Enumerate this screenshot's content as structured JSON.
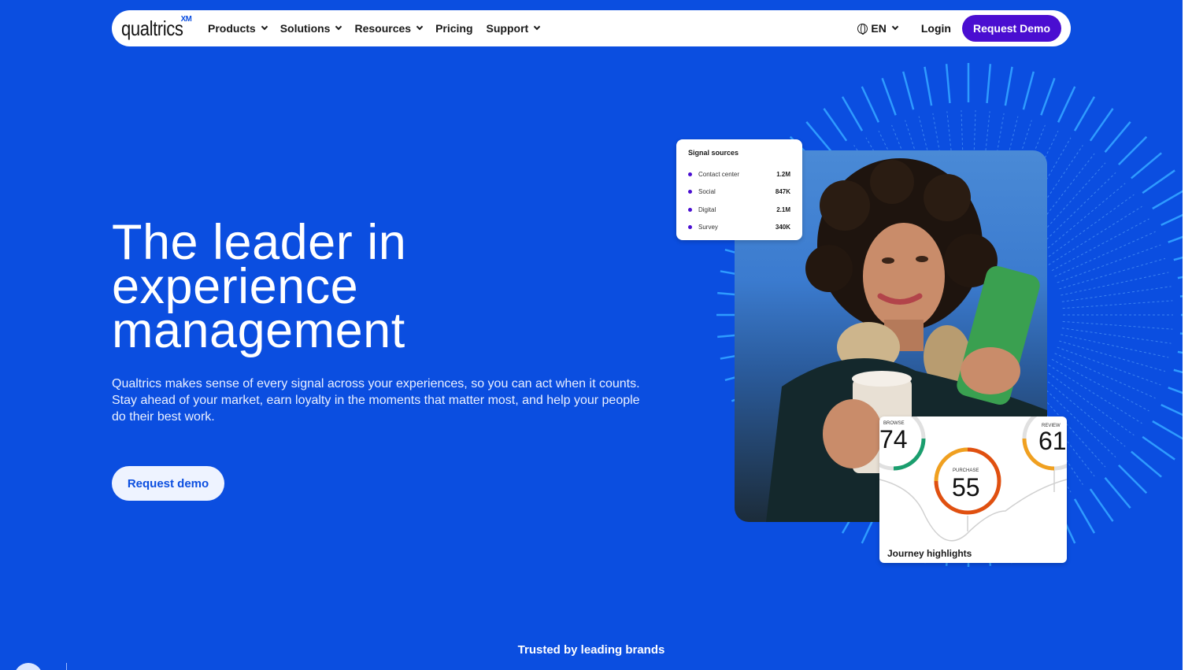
{
  "nav": {
    "logo": "qualtrics",
    "logo_sup": "XM",
    "items": [
      {
        "label": "Products",
        "dropdown": true
      },
      {
        "label": "Solutions",
        "dropdown": true
      },
      {
        "label": "Resources",
        "dropdown": true
      },
      {
        "label": "Pricing",
        "dropdown": false
      },
      {
        "label": "Support",
        "dropdown": true
      }
    ],
    "language": "EN",
    "login": "Login",
    "request_demo": "Request Demo"
  },
  "hero": {
    "title_line1": "The leader in",
    "title_line2": "experience",
    "title_line3": "management",
    "subtitle": "Qualtrics makes sense of every signal across your experiences, so you can act when it counts. Stay ahead of your market, earn loyalty in the moments that matter most, and help your people do their best work.",
    "cta": "Request demo"
  },
  "signal_card": {
    "title": "Signal sources",
    "rows": [
      {
        "label": "Contact center",
        "value": "1.2M"
      },
      {
        "label": "Social",
        "value": "847K"
      },
      {
        "label": "Digital",
        "value": "2.1M"
      },
      {
        "label": "Survey",
        "value": "340K"
      }
    ]
  },
  "journey_card": {
    "title": "Journey highlights",
    "browse_label": "BROWSE",
    "browse_value": "74",
    "review_label": "REVIEW",
    "review_value": "61",
    "purchase_label": "PURCHASE",
    "purchase_value": "55"
  },
  "footer": {
    "trusted": "Trusted by leading brands"
  },
  "colors": {
    "background": "#0b4ee0",
    "accent": "#4a0ed1",
    "browse_ring": "#1a9e6e",
    "review_ring": "#f0a020",
    "purchase_ring": "#e05010"
  }
}
